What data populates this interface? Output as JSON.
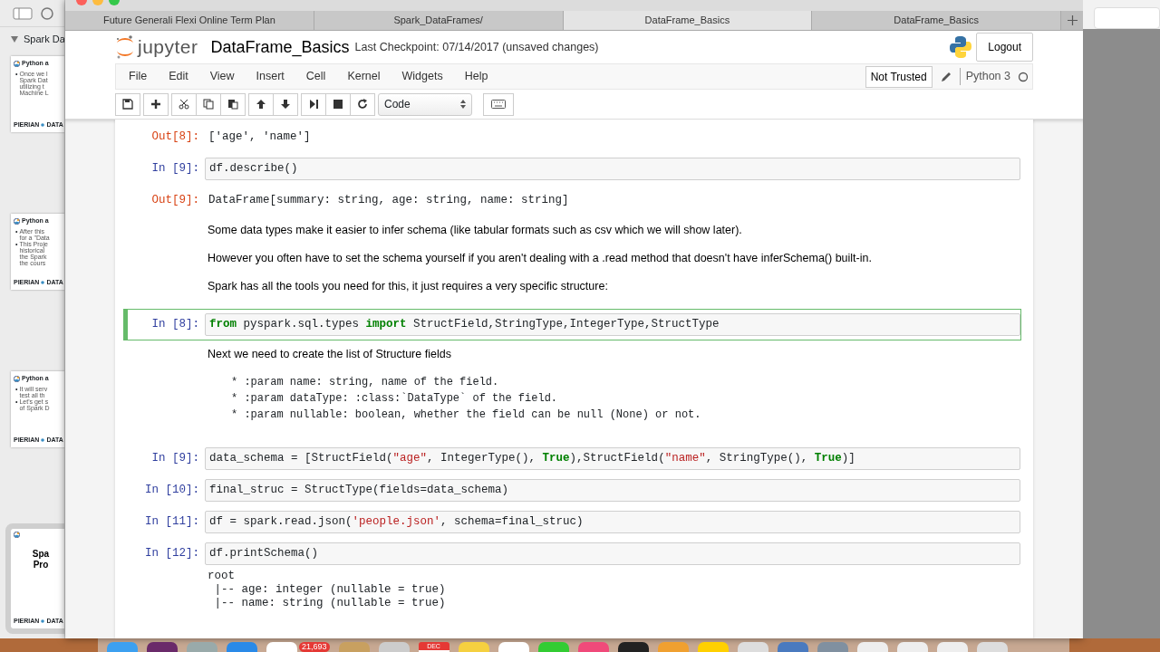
{
  "side_app": {
    "heading": "Spark Da",
    "slides": [
      {
        "title": "Python a",
        "bullets": [
          {
            "marker": "•",
            "lines": [
              "Once we l",
              "Spark Dat",
              "utilizing t",
              "Machine L"
            ]
          }
        ],
        "footer": [
          "PIERIAN",
          "DATA"
        ],
        "selected": false
      },
      {
        "title": "Python a",
        "bullets": [
          {
            "marker": "•",
            "lines": [
              "After this",
              "for a \"Data"
            ]
          },
          {
            "marker": "•",
            "lines": [
              "This Proje",
              "historical",
              "the Spark",
              "the cours"
            ]
          }
        ],
        "footer": [
          "PIERIAN",
          "DATA"
        ],
        "selected": false
      },
      {
        "title": "Python a",
        "bullets": [
          {
            "marker": "•",
            "lines": [
              "It will serv",
              "test all th"
            ]
          },
          {
            "marker": "•",
            "lines": [
              "Let's get s",
              "of Spark D"
            ]
          }
        ],
        "footer": [
          "PIERIAN",
          "DATA"
        ],
        "selected": false
      },
      {
        "big_title": [
          "Spa",
          "Pro"
        ],
        "footer": [
          "PIERIAN",
          "DATA"
        ],
        "selected": true
      }
    ]
  },
  "browser": {
    "tabs": [
      {
        "label": "Future Generali Flexi Online Term Plan",
        "selected": false
      },
      {
        "label": "Spark_DataFrames/",
        "selected": false
      },
      {
        "label": "DataFrame_Basics",
        "selected": true
      },
      {
        "label": "DataFrame_Basics",
        "selected": false
      }
    ]
  },
  "header": {
    "logo_text": "jupyter",
    "notebook_name": "DataFrame_Basics",
    "checkpoint": "Last Checkpoint: 07/14/2017 (unsaved changes)",
    "logout": "Logout"
  },
  "menu": [
    "File",
    "Edit",
    "View",
    "Insert",
    "Cell",
    "Kernel",
    "Widgets",
    "Help"
  ],
  "trust": "Not Trusted",
  "kernel": "Python 3",
  "toolbar": {
    "cell_type": "Code"
  },
  "cells": [
    {
      "kind": "output",
      "prompt": "Out[8]:",
      "text": "['age', 'name']"
    },
    {
      "kind": "code",
      "prompt": "In [9]:",
      "selected": false,
      "tokens": [
        {
          "t": "df.describe()",
          "kind": "plain"
        }
      ]
    },
    {
      "kind": "output",
      "prompt": "Out[9]:",
      "text": "DataFrame[summary: string, age: string, name: string]"
    },
    {
      "kind": "markdown",
      "paragraphs": [
        "Some data types make it easier to infer schema (like tabular formats such as csv which we will show later).",
        "However you often have to set the schema yourself if you aren't dealing with a .read method that doesn't have inferSchema() built-in.",
        "Spark has all the tools you need for this, it just requires a very specific structure:"
      ]
    },
    {
      "kind": "code",
      "prompt": "In [8]:",
      "selected": true,
      "tokens": [
        {
          "t": "from",
          "kind": "kw"
        },
        {
          "t": " pyspark.sql.types ",
          "kind": "plain"
        },
        {
          "t": "import",
          "kind": "kw"
        },
        {
          "t": " StructField,StringType,IntegerType,StructType",
          "kind": "plain"
        }
      ]
    },
    {
      "kind": "markdown",
      "paragraphs": [
        "Next we need to create the list of Structure fields"
      ],
      "code_lines": [
        "* :param name: string, name of the field.",
        "* :param dataType: :class:`DataType` of the field.",
        "* :param nullable: boolean, whether the field can be null (None) or not."
      ]
    },
    {
      "kind": "code",
      "prompt": "In [9]:",
      "selected": false,
      "tokens": [
        {
          "t": "data_schema = [StructField(",
          "kind": "plain"
        },
        {
          "t": "\"age\"",
          "kind": "str"
        },
        {
          "t": ", IntegerType(), ",
          "kind": "plain"
        },
        {
          "t": "True",
          "kind": "kw"
        },
        {
          "t": "),StructField(",
          "kind": "plain"
        },
        {
          "t": "\"name\"",
          "kind": "str"
        },
        {
          "t": ", StringType(), ",
          "kind": "plain"
        },
        {
          "t": "True",
          "kind": "kw"
        },
        {
          "t": ")]",
          "kind": "plain"
        }
      ]
    },
    {
      "kind": "code",
      "prompt": "In [10]:",
      "selected": false,
      "tokens": [
        {
          "t": "final_struc = StructType(fields=data_schema)",
          "kind": "plain"
        }
      ]
    },
    {
      "kind": "code",
      "prompt": "In [11]:",
      "selected": false,
      "tokens": [
        {
          "t": "df = spark.read.json(",
          "kind": "plain"
        },
        {
          "t": "'people.json'",
          "kind": "str"
        },
        {
          "t": ", schema=final_struc)",
          "kind": "plain"
        }
      ]
    },
    {
      "kind": "code",
      "prompt": "In [12]:",
      "selected": false,
      "tokens": [
        {
          "t": "df.printSchema()",
          "kind": "plain"
        }
      ]
    },
    {
      "kind": "stream",
      "lines": [
        "root",
        " |-- age: integer (nullable = true)",
        " |-- name: string (nullable = true)"
      ]
    }
  ],
  "dock": {
    "badge": "21,693",
    "calendar_month": "DEC"
  }
}
